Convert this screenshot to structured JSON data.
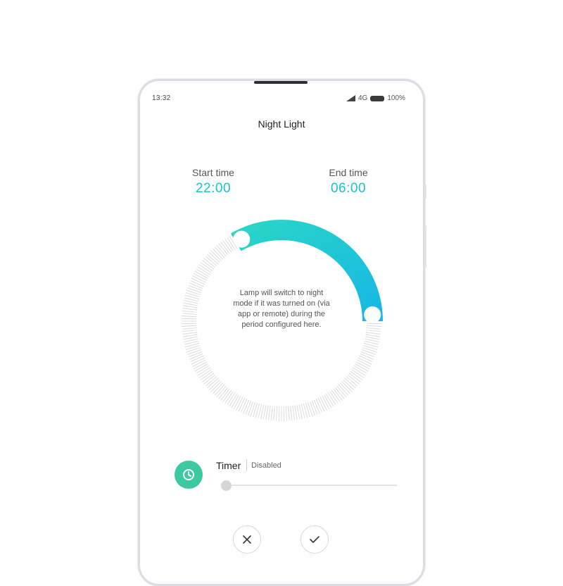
{
  "status_bar": {
    "time": "13:32",
    "network": "4G",
    "battery": "100%"
  },
  "header": {
    "title": "Night Light"
  },
  "schedule": {
    "start": {
      "label": "Start time",
      "value": "22:00"
    },
    "end": {
      "label": "End time",
      "value": "06:00"
    }
  },
  "dial": {
    "description": "Lamp will switch to night mode if it was turned on (via app or remote) during the period configured here."
  },
  "timer": {
    "label": "Timer",
    "status": "Disabled",
    "icon": "clock-icon",
    "slider_level": 0
  },
  "actions": {
    "cancel_icon": "close-icon",
    "confirm_icon": "check-icon"
  },
  "colors": {
    "accent": "#16c3c8",
    "arc_start": "#2ad8c4",
    "arc_end": "#16b6e6",
    "timer_icon_bg": "#3cc9a2"
  }
}
